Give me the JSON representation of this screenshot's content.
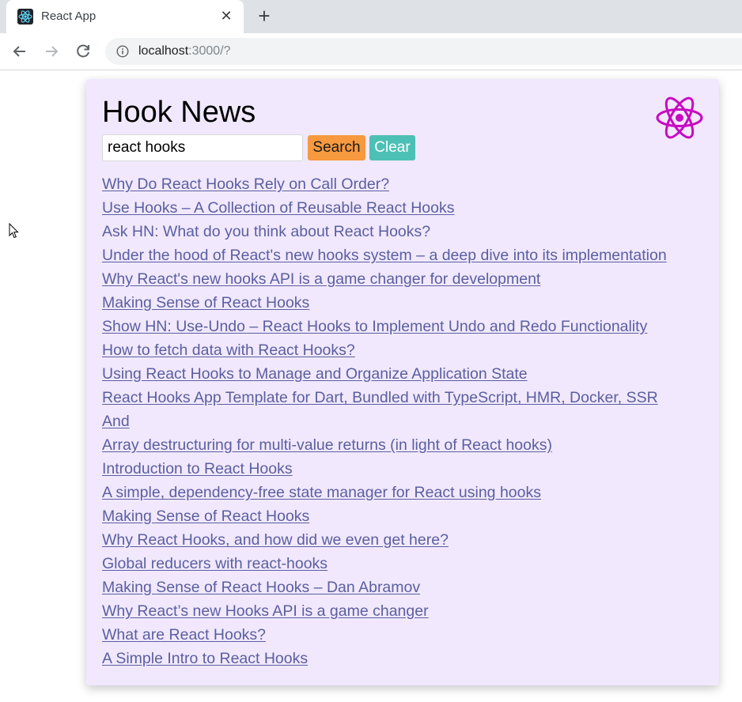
{
  "browser": {
    "tab_title": "React App",
    "url_host": "localhost",
    "url_rest": ":3000/?"
  },
  "app": {
    "title": "Hook News",
    "search": {
      "value": "react hooks",
      "button_label": "Search",
      "clear_label": "Clear"
    },
    "results": [
      {
        "title": "Why Do React Hooks Rely on Call Order?",
        "linked": true
      },
      {
        "title": "Use Hooks – A Collection of Reusable React Hooks",
        "linked": true
      },
      {
        "title": "Ask HN: What do you think about React Hooks?",
        "linked": false
      },
      {
        "title": "Under the hood of React's new hooks system – a deep dive into its implementation",
        "linked": true
      },
      {
        "title": "Why React's new hooks API is a game changer for development",
        "linked": true
      },
      {
        "title": "Making Sense of React Hooks",
        "linked": true
      },
      {
        "title": "Show HN: Use-Undo – React Hooks to Implement Undo and Redo Functionality",
        "linked": true
      },
      {
        "title": "How to fetch data with React Hooks?",
        "linked": true
      },
      {
        "title": "Using React Hooks to Manage and Organize Application State",
        "linked": true
      },
      {
        "title": "React Hooks App Template for Dart, Bundled with TypeScript, HMR, Docker, SSR And",
        "linked": true
      },
      {
        "title": "Array destructuring for multi-value returns (in light of React hooks)",
        "linked": true
      },
      {
        "title": "Introduction to React Hooks",
        "linked": true
      },
      {
        "title": "A simple, dependency-free state manager for React using hooks",
        "linked": true
      },
      {
        "title": "Making Sense of React Hooks",
        "linked": true
      },
      {
        "title": "Why React Hooks, and how did we even get here?",
        "linked": true
      },
      {
        "title": "Global reducers with react-hooks",
        "linked": true
      },
      {
        "title": "Making Sense of React Hooks – Dan Abramov",
        "linked": true
      },
      {
        "title": "Why React’s new Hooks API is a game changer",
        "linked": true
      },
      {
        "title": "What are React Hooks?",
        "linked": true
      },
      {
        "title": "A Simple Intro to React Hooks",
        "linked": true
      }
    ]
  },
  "colors": {
    "card_bg": "#f1e8fd",
    "link": "#5a5fa0",
    "search_button": "#f6993f",
    "clear_button": "#4dc0b5",
    "react_logo": "#c70ac2"
  },
  "icons": {
    "favicon": "react-icon",
    "back": "arrow-left-icon",
    "forward": "arrow-right-icon",
    "reload": "reload-icon",
    "info": "info-icon",
    "logo": "react-icon"
  }
}
